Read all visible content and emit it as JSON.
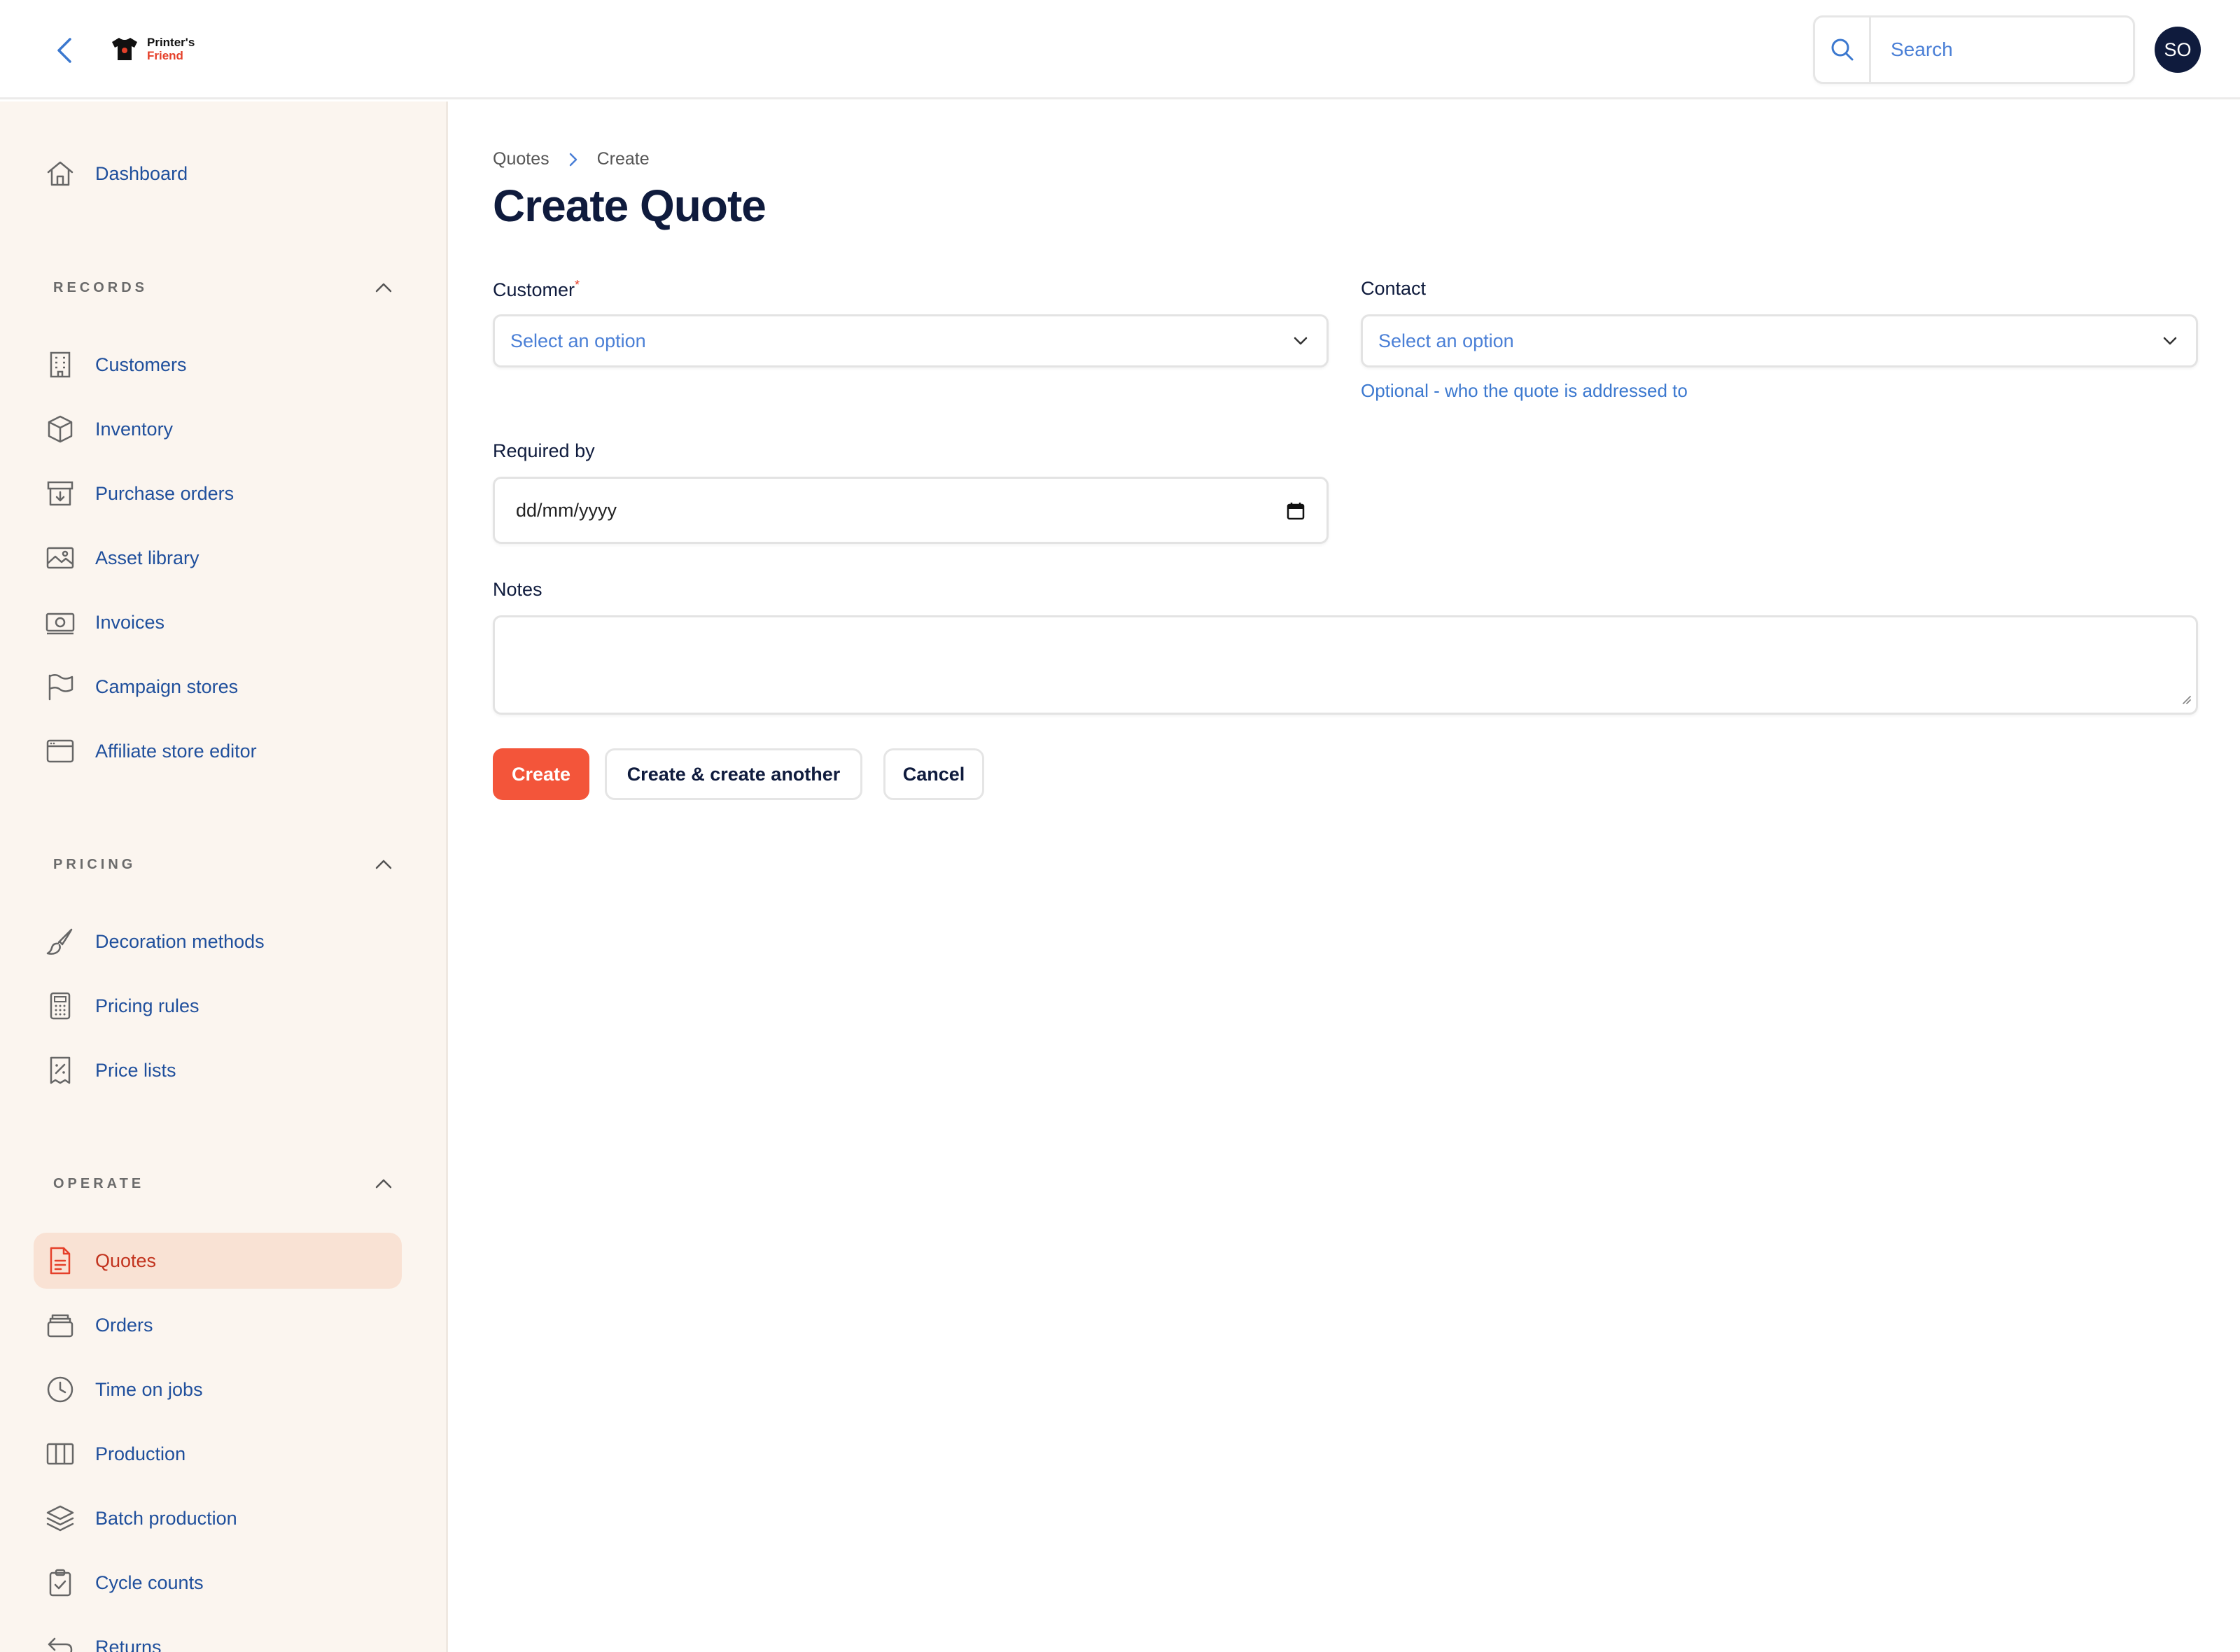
{
  "header": {
    "logo_line1": "Printer's",
    "logo_line2": "Friend",
    "search_placeholder": "Search",
    "avatar_initials": "SO"
  },
  "sidebar": {
    "dashboard": "Dashboard",
    "sections": {
      "records": "RECORDS",
      "pricing": "PRICING",
      "operate": "OPERATE"
    },
    "records_items": [
      {
        "label": "Customers",
        "icon": "building-icon"
      },
      {
        "label": "Inventory",
        "icon": "cube-icon"
      },
      {
        "label": "Purchase orders",
        "icon": "archive-in-icon"
      },
      {
        "label": "Asset library",
        "icon": "image-icon"
      },
      {
        "label": "Invoices",
        "icon": "banknote-icon"
      },
      {
        "label": "Campaign stores",
        "icon": "flag-icon"
      },
      {
        "label": "Affiliate store editor",
        "icon": "browser-window-icon"
      }
    ],
    "pricing_items": [
      {
        "label": "Decoration methods",
        "icon": "paintbrush-icon"
      },
      {
        "label": "Pricing rules",
        "icon": "calculator-icon"
      },
      {
        "label": "Price lists",
        "icon": "receipt-percent-icon"
      }
    ],
    "operate_items": [
      {
        "label": "Quotes",
        "icon": "document-icon",
        "active": true
      },
      {
        "label": "Orders",
        "icon": "stack-icon"
      },
      {
        "label": "Time on jobs",
        "icon": "clock-icon"
      },
      {
        "label": "Production",
        "icon": "columns-icon"
      },
      {
        "label": "Batch production",
        "icon": "layers-icon"
      },
      {
        "label": "Cycle counts",
        "icon": "clipboard-check-icon"
      },
      {
        "label": "Returns",
        "icon": "return-arrow-icon"
      }
    ]
  },
  "breadcrumb": {
    "parent": "Quotes",
    "current": "Create"
  },
  "page": {
    "title": "Create Quote"
  },
  "form": {
    "customer_label": "Customer",
    "customer_required_mark": "*",
    "customer_placeholder": "Select an option",
    "contact_label": "Contact",
    "contact_placeholder": "Select an option",
    "contact_helper": "Optional - who the quote is addressed to",
    "required_by_label": "Required by",
    "required_by_placeholder": "dd/mm/yyyy",
    "notes_label": "Notes",
    "notes_value": ""
  },
  "actions": {
    "create": "Create",
    "create_another": "Create & create another",
    "cancel": "Cancel"
  },
  "colors": {
    "accent": "#f3553a",
    "sidebar_bg": "#fbf5ef",
    "active_bg": "#f9e2d4",
    "link_blue": "#1f4f9c",
    "title_navy": "#0f1b3d"
  }
}
